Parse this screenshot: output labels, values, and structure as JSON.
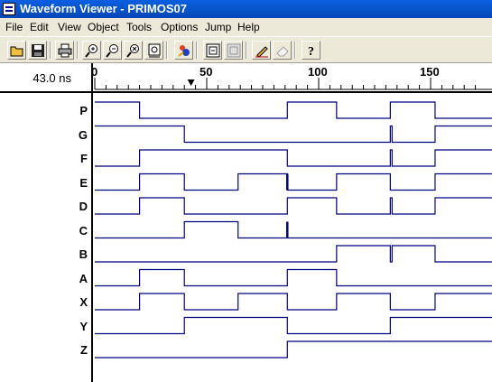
{
  "window": {
    "title": "Waveform Viewer - PRIMOS07"
  },
  "menu": [
    "File",
    "Edit",
    "View",
    "Object",
    "Tools",
    "Options",
    "Jump",
    "Help"
  ],
  "toolbar": {
    "buttons": [
      "open-icon",
      "save-icon",
      "print-icon",
      "zoom-in-icon",
      "zoom-out-icon",
      "zoom-fit-icon",
      "zoom-full-icon",
      "run-icon",
      "grid-on-icon",
      "grid-off-icon",
      "pencil-icon",
      "eraser-icon",
      "help-icon"
    ]
  },
  "cursor": {
    "time_label": "43.0 ns",
    "time": 43
  },
  "ruler": {
    "labels": [
      "0",
      "50",
      "100",
      "150"
    ],
    "values": [
      0,
      50,
      100,
      150
    ],
    "t_end": 170
  },
  "colors": {
    "wave": "#000080",
    "cursor_marker": "#000000"
  },
  "signals": [
    {
      "name": "P",
      "edges": [
        [
          0,
          1
        ],
        [
          20,
          0
        ],
        [
          86,
          1
        ],
        [
          108,
          0
        ],
        [
          132,
          1
        ],
        [
          152,
          0
        ]
      ]
    },
    {
      "name": "G",
      "edges": [
        [
          0,
          1
        ],
        [
          40,
          0
        ],
        [
          132,
          1
        ],
        [
          132.8,
          0
        ],
        [
          152,
          1
        ]
      ]
    },
    {
      "name": "F",
      "edges": [
        [
          0,
          0
        ],
        [
          20,
          1
        ],
        [
          86,
          0
        ],
        [
          132,
          1
        ],
        [
          132.8,
          0
        ],
        [
          152,
          1
        ]
      ]
    },
    {
      "name": "E",
      "edges": [
        [
          0,
          0
        ],
        [
          20,
          1
        ],
        [
          40,
          0
        ],
        [
          64,
          1
        ],
        [
          86,
          0
        ],
        [
          108,
          1
        ],
        [
          132,
          0
        ],
        [
          152,
          1
        ]
      ],
      "glitch": [
        86
      ]
    },
    {
      "name": "D",
      "edges": [
        [
          0,
          0
        ],
        [
          20,
          1
        ],
        [
          40,
          0
        ],
        [
          86,
          1
        ],
        [
          108,
          0
        ],
        [
          132,
          1
        ],
        [
          132.8,
          0
        ],
        [
          152,
          1
        ]
      ]
    },
    {
      "name": "C",
      "edges": [
        [
          0,
          0
        ],
        [
          40,
          1
        ],
        [
          64,
          0
        ]
      ],
      "glitch": [
        86
      ]
    },
    {
      "name": "B",
      "edges": [
        [
          0,
          0
        ],
        [
          108,
          1
        ],
        [
          132,
          0
        ],
        [
          132.8,
          1
        ],
        [
          152,
          0
        ]
      ]
    },
    {
      "name": "A",
      "edges": [
        [
          0,
          0
        ],
        [
          20,
          1
        ],
        [
          40,
          0
        ],
        [
          86,
          1
        ],
        [
          108,
          0
        ]
      ]
    },
    {
      "name": "X",
      "edges": [
        [
          0,
          0
        ],
        [
          20,
          1
        ],
        [
          40,
          0
        ],
        [
          64,
          1
        ],
        [
          86,
          0
        ],
        [
          108,
          1
        ],
        [
          132,
          0
        ],
        [
          152,
          1
        ]
      ]
    },
    {
      "name": "Y",
      "edges": [
        [
          0,
          0
        ],
        [
          40,
          1
        ],
        [
          86,
          0
        ],
        [
          132,
          1
        ]
      ]
    },
    {
      "name": "Z",
      "edges": [
        [
          0,
          0
        ],
        [
          86,
          1
        ]
      ]
    }
  ]
}
